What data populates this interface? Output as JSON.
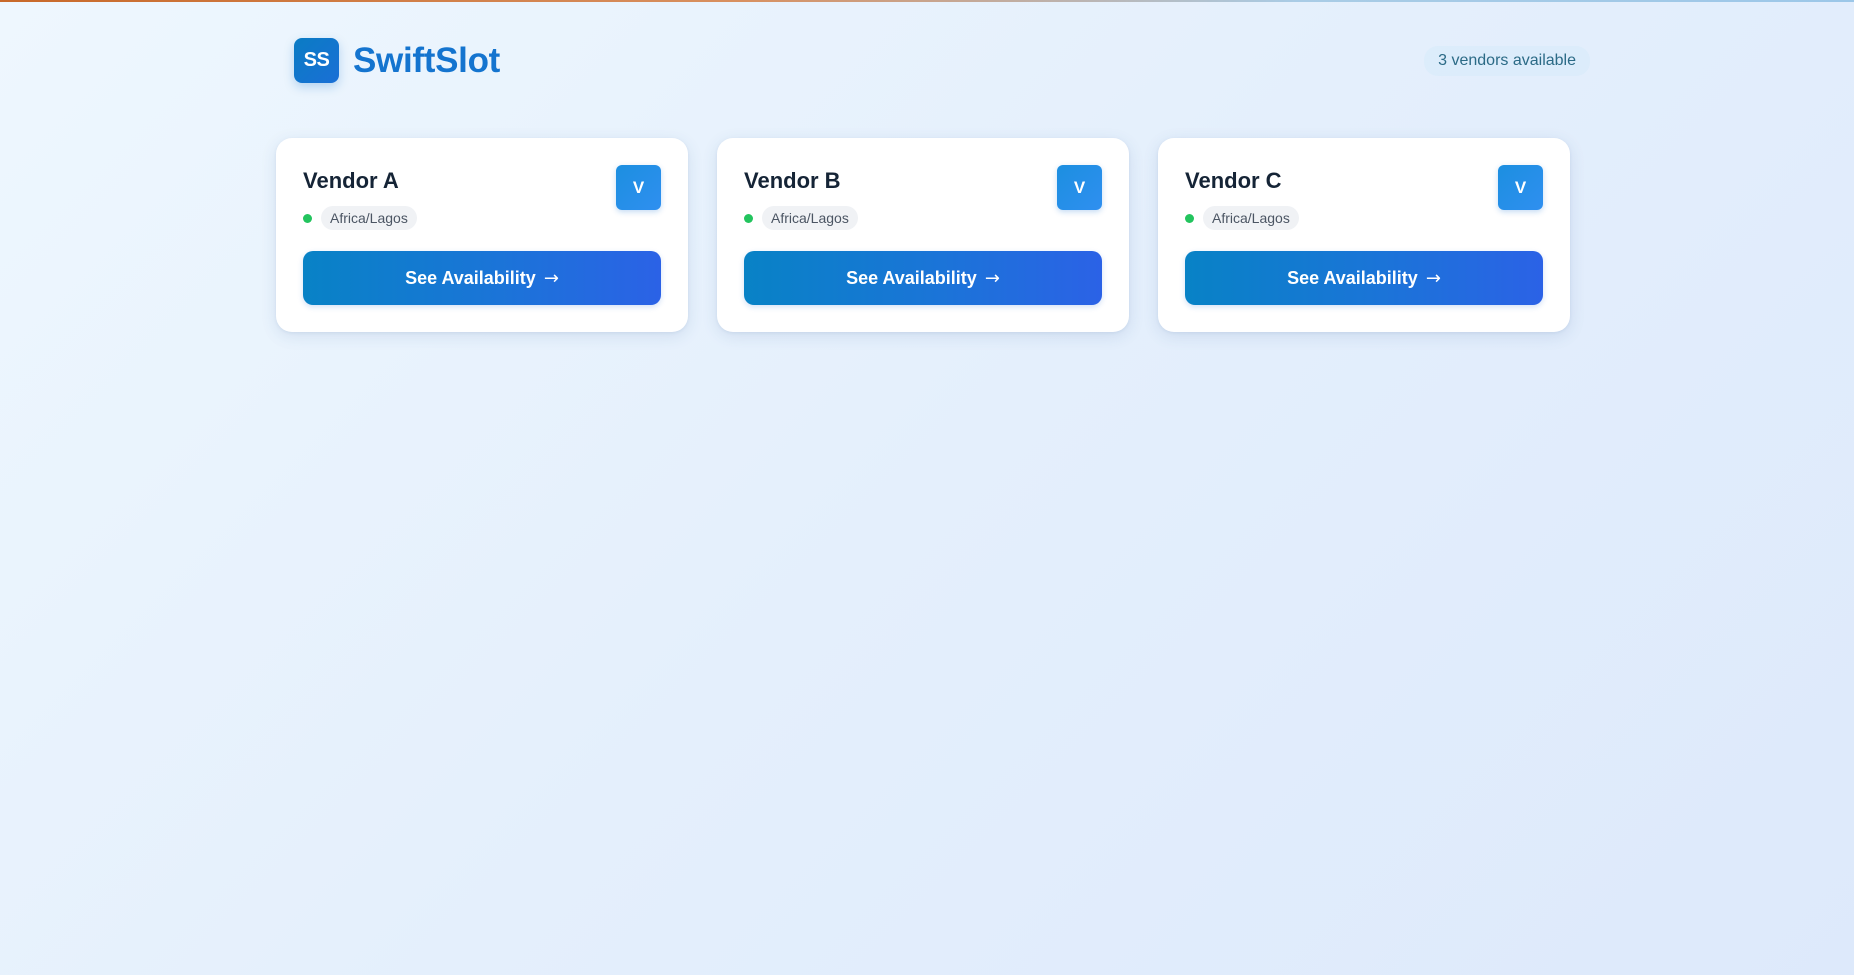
{
  "app": {
    "logo_text": "SS",
    "name": "SwiftSlot"
  },
  "header": {
    "vendor_count": "3 vendors available"
  },
  "vendors": [
    {
      "name": "Vendor A",
      "avatar": "V",
      "timezone": "Africa/Lagos",
      "button_label": "See Availability",
      "arrow": "→"
    },
    {
      "name": "Vendor B",
      "avatar": "V",
      "timezone": "Africa/Lagos",
      "button_label": "See Availability",
      "arrow": "→"
    },
    {
      "name": "Vendor C",
      "avatar": "V",
      "timezone": "Africa/Lagos",
      "button_label": "See Availability",
      "arrow": "→"
    }
  ],
  "colors": {
    "brand": "#1474cf",
    "button_start": "#0882c6",
    "button_end": "#2b62e6",
    "status_online": "#23c45e"
  },
  "icons": {
    "status": "online-dot-icon",
    "button_arrow": "arrow-right-icon"
  }
}
